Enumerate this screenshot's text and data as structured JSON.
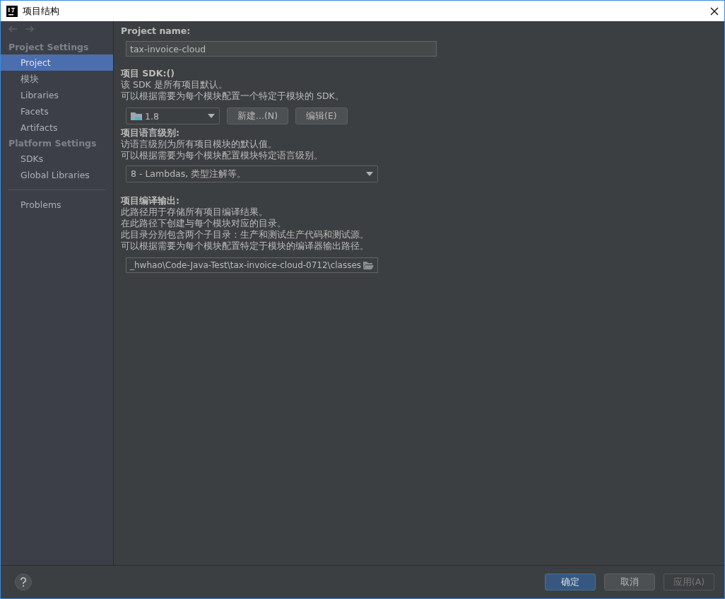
{
  "window": {
    "title": "项目结构"
  },
  "sidebar": {
    "groups": [
      {
        "heading": "Project Settings",
        "items": [
          {
            "label": "Project",
            "selected": true
          },
          {
            "label": "模块",
            "selected": false
          },
          {
            "label": "Libraries",
            "selected": false
          },
          {
            "label": "Facets",
            "selected": false
          },
          {
            "label": "Artifacts",
            "selected": false
          }
        ]
      },
      {
        "heading": "Platform Settings",
        "items": [
          {
            "label": "SDKs",
            "selected": false
          },
          {
            "label": "Global Libraries",
            "selected": false
          }
        ]
      }
    ],
    "footer_items": [
      {
        "label": "Problems",
        "selected": false
      }
    ]
  },
  "project_name": {
    "label": "Project name:",
    "value": "tax-invoice-cloud"
  },
  "sdk": {
    "label": "项目 SDK:()",
    "lines": [
      "该 SDK 是所有项目默认。",
      "可以根据需要为每个模块配置一个特定于模块的 SDK。"
    ],
    "value": "1.8",
    "buttons": [
      "新建...(N)",
      "编辑(E)"
    ]
  },
  "language_level": {
    "label": "项目语言级别:",
    "lines": [
      "访语言级别为所有项目模块的默认值。",
      "可以根据需要为每个模块配置模块特定语言级别。"
    ],
    "value": "8 - Lambdas, 类型注解等。"
  },
  "compiler_output": {
    "label": "项目编译输出:",
    "lines": [
      "此路径用于存储所有项目编译结果。",
      "在此路径下创建与每个模块对应的目录。",
      "此目录分别包含两个子目录：生产和测试生产代码和测试源。",
      "可以根据需要为每个模块配置特定于模块的编译器输出路径。"
    ],
    "value": "_hwhao\\Code-Java-Test\\tax-invoice-cloud-0712\\classes"
  },
  "buttons": [
    {
      "label": "确定",
      "kind": "primary",
      "disabled": false
    },
    {
      "label": "取消",
      "kind": "normal",
      "disabled": false
    },
    {
      "label": "应用(A)",
      "kind": "normal",
      "disabled": true
    }
  ]
}
